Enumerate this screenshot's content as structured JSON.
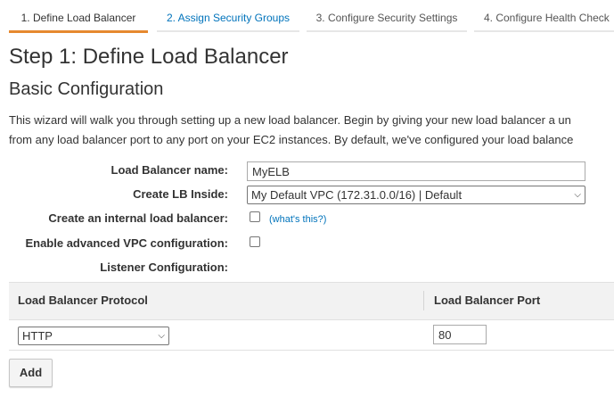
{
  "tabs": [
    {
      "label": "1. Define Load Balancer",
      "active": true
    },
    {
      "label": "2. Assign Security Groups",
      "active": false
    },
    {
      "label": "3. Configure Security Settings",
      "active": false
    },
    {
      "label": "4. Configure Health Check",
      "active": false
    }
  ],
  "page": {
    "title": "Step 1: Define Load Balancer",
    "section_title": "Basic Configuration",
    "intro_line1": "This wizard will walk you through setting up a new load balancer. Begin by giving your new load balancer a un",
    "intro_line2": "from any load balancer port to any port on your EC2 instances. By default, we've configured your load balance"
  },
  "form": {
    "name_label": "Load Balancer name:",
    "name_value": "MyELB",
    "create_inside_label": "Create LB Inside:",
    "create_inside_value": "My Default VPC (172.31.0.0/16) | Default",
    "internal_label": "Create an internal load balancer:",
    "internal_checked": false,
    "whats_this": "(what's this?)",
    "advanced_vpc_label": "Enable advanced VPC configuration:",
    "advanced_vpc_checked": false,
    "listener_label": "Listener Configuration:"
  },
  "listener_table": {
    "columns": [
      "Load Balancer Protocol",
      "Load Balancer Port"
    ],
    "rows": [
      {
        "protocol": "HTTP",
        "port": "80"
      }
    ]
  },
  "buttons": {
    "add": "Add"
  },
  "colors": {
    "active_tab_underline": "#e6892f",
    "link": "#0073bb",
    "table_header_bg": "#f2f2f2"
  }
}
